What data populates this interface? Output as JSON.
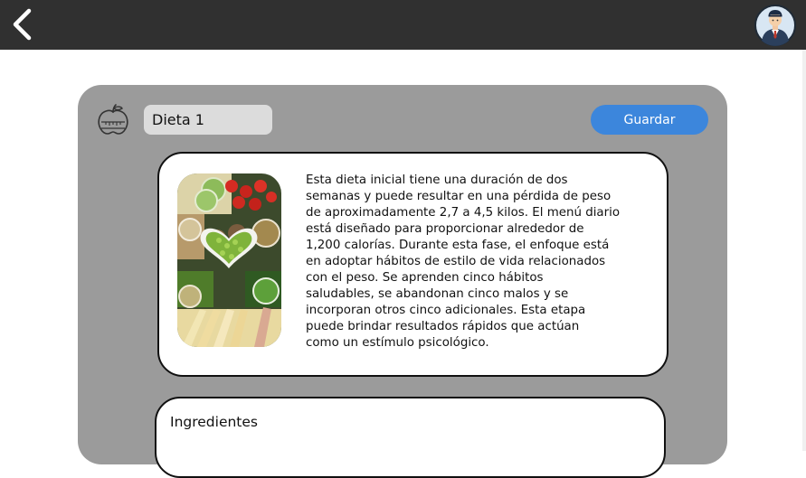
{
  "header": {
    "back_icon": "chevron-left-icon",
    "avatar_icon": "user-avatar-icon",
    "bar_color": "#303030"
  },
  "diet": {
    "icon": "weight-scale-apple-icon",
    "name_value": "Dieta 1",
    "save_label": "Guardar",
    "save_color": "#3c86dc",
    "image": "healthy-food-heart-image",
    "description": "Esta dieta inicial tiene una duración de dos\nsemanas y puede resultar en una pérdida de peso\nde aproximadamente 2,7 a 4,5 kilos. El menú diario\nestá diseñado para proporcionar alrededor de\n1,200 calorías. Durante esta fase, el enfoque está\nen adoptar hábitos de estilo de vida relacionados\ncon el peso. Se aprenden cinco hábitos\nsaludables, se abandonan cinco malos y se\nincorporan otros cinco adicionales. Esta etapa\npuede brindar resultados rápidos que actúan\ncomo un estímulo psicológico."
  },
  "ingredients": {
    "title": "Ingredientes"
  }
}
